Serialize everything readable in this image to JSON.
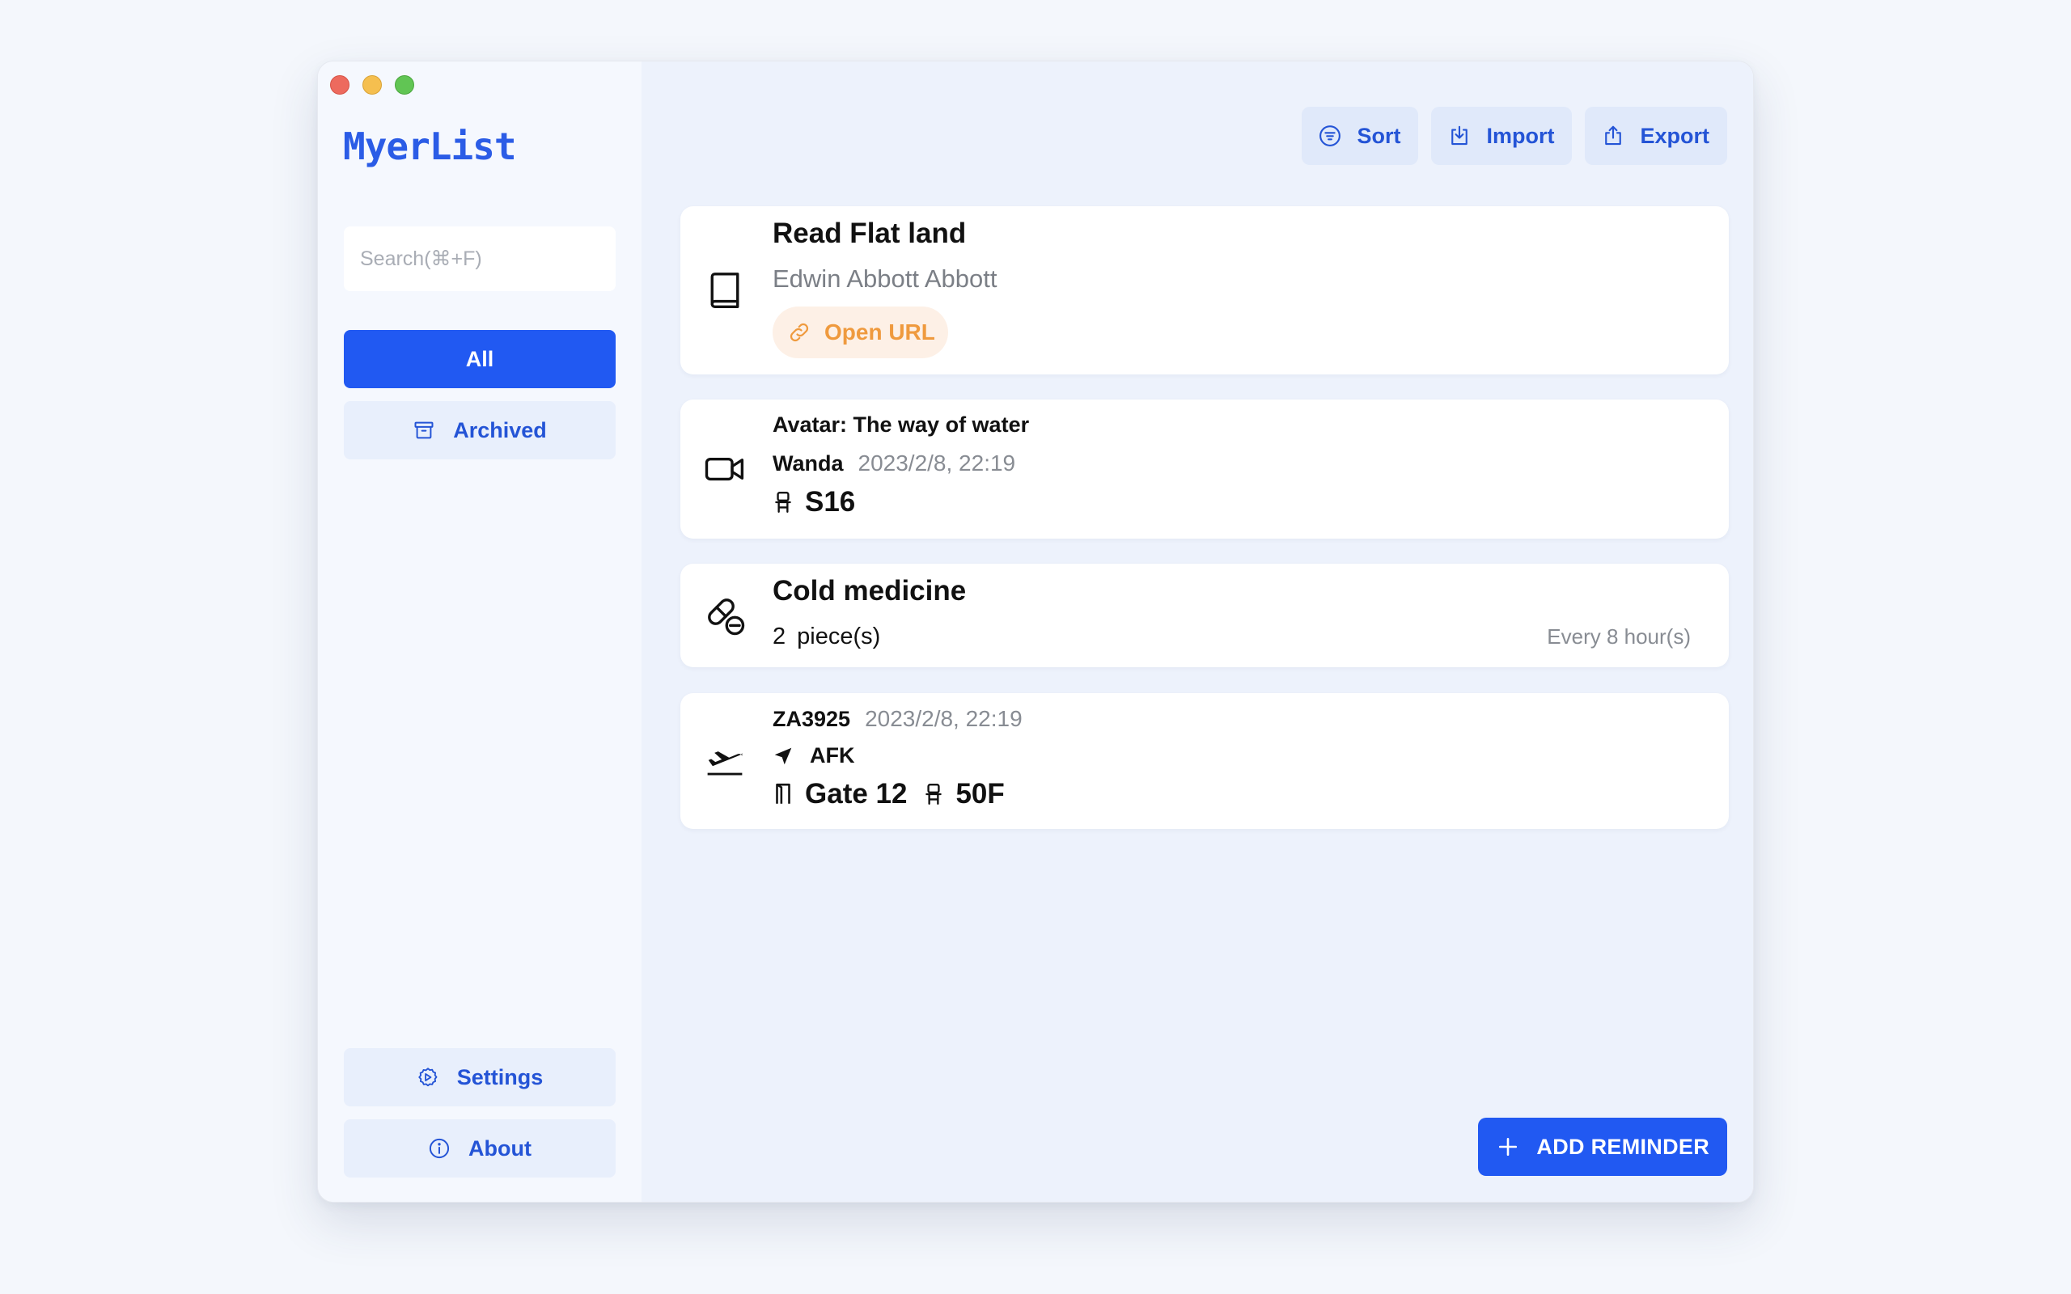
{
  "app": {
    "title": "MyerList"
  },
  "window_controls": [
    "close",
    "minimize",
    "zoom"
  ],
  "sidebar": {
    "search_placeholder": "Search(⌘+F)",
    "search_value": "",
    "nav": [
      {
        "label": "All",
        "selected": true
      },
      {
        "label": "Archived",
        "icon": "archive-icon",
        "selected": false
      }
    ],
    "footer": [
      {
        "label": "Settings",
        "icon": "gear-icon"
      },
      {
        "label": "About",
        "icon": "info-icon"
      }
    ]
  },
  "toolbar": {
    "sort_label": "Sort",
    "import_label": "Import",
    "export_label": "Export"
  },
  "reminders": [
    {
      "kind": "book",
      "icon": "book-icon",
      "title": "Read Flat land",
      "author": "Edwin Abbott Abbott",
      "link_label": "Open URL"
    },
    {
      "kind": "movie",
      "icon": "video-camera-icon",
      "title": "Avatar: The way of water",
      "cinema": "Wanda",
      "datetime": "2023/2/8, 22:19",
      "seat": "S16"
    },
    {
      "kind": "medicine",
      "icon": "pill-icon",
      "title": "Cold medicine",
      "dose_count": "2",
      "dose_unit": "piece(s)",
      "frequency": "Every 8 hour(s)"
    },
    {
      "kind": "flight",
      "icon": "airplane-departure-icon",
      "flight_no": "ZA3925",
      "datetime": "2023/2/8, 22:19",
      "destination": "AFK",
      "gate": "Gate 12",
      "seat": "50F"
    }
  ],
  "add_button_label": "ADD REMINDER",
  "colors": {
    "accent": "#2159f2",
    "accent_text": "#2454d6",
    "url_chip_text": "#ef9a3e",
    "url_chip_bg": "#fdf0e6"
  }
}
